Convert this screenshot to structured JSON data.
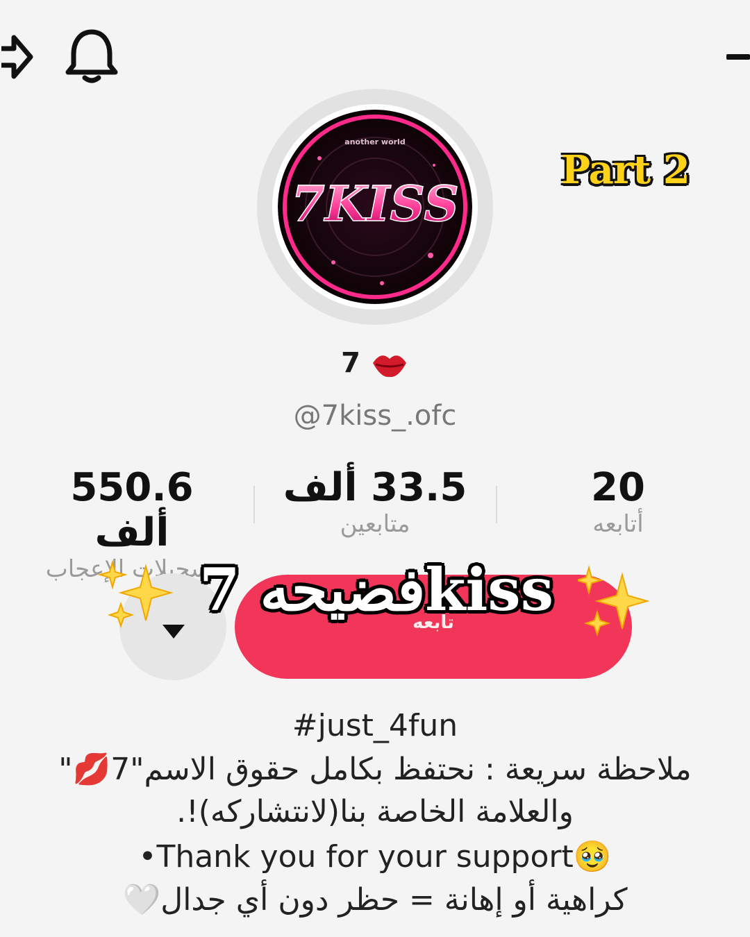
{
  "overlay": {
    "part": "Part 2",
    "title": "فضيحه  7kiss"
  },
  "profile": {
    "display_name": "7",
    "username": "@7kiss_.ofc",
    "avatar_logo": "7KISS",
    "avatar_tagline": "another world"
  },
  "stats": {
    "likes": {
      "value": "550.6 ألف",
      "label": "تسجيلات الإعجاب"
    },
    "followers": {
      "value": "33.5 ألف",
      "label": "متابعين"
    },
    "following": {
      "value": "20",
      "label": "أتابعه"
    }
  },
  "buttons": {
    "follow": "تابعه"
  },
  "bio": {
    "line1": "#just_4fun",
    "line2": "ملاحظة سريعة : نحتفظ بكامل حقوق الاسم\"7💋\"",
    "line3": "والعلامة الخاصة بنا(لانتشاركه)!.",
    "line4": "•Thank you for your support🥹",
    "line5": "كراهية أو إهانة = حظر دون أي جدال🤍"
  },
  "icons": [
    "share-icon",
    "bell-icon",
    "menu-icon",
    "lips-icon",
    "sparkles-icon",
    "caret-down-icon"
  ],
  "colors": {
    "accent": "#f1365a",
    "part_label": "#ffd21a"
  }
}
